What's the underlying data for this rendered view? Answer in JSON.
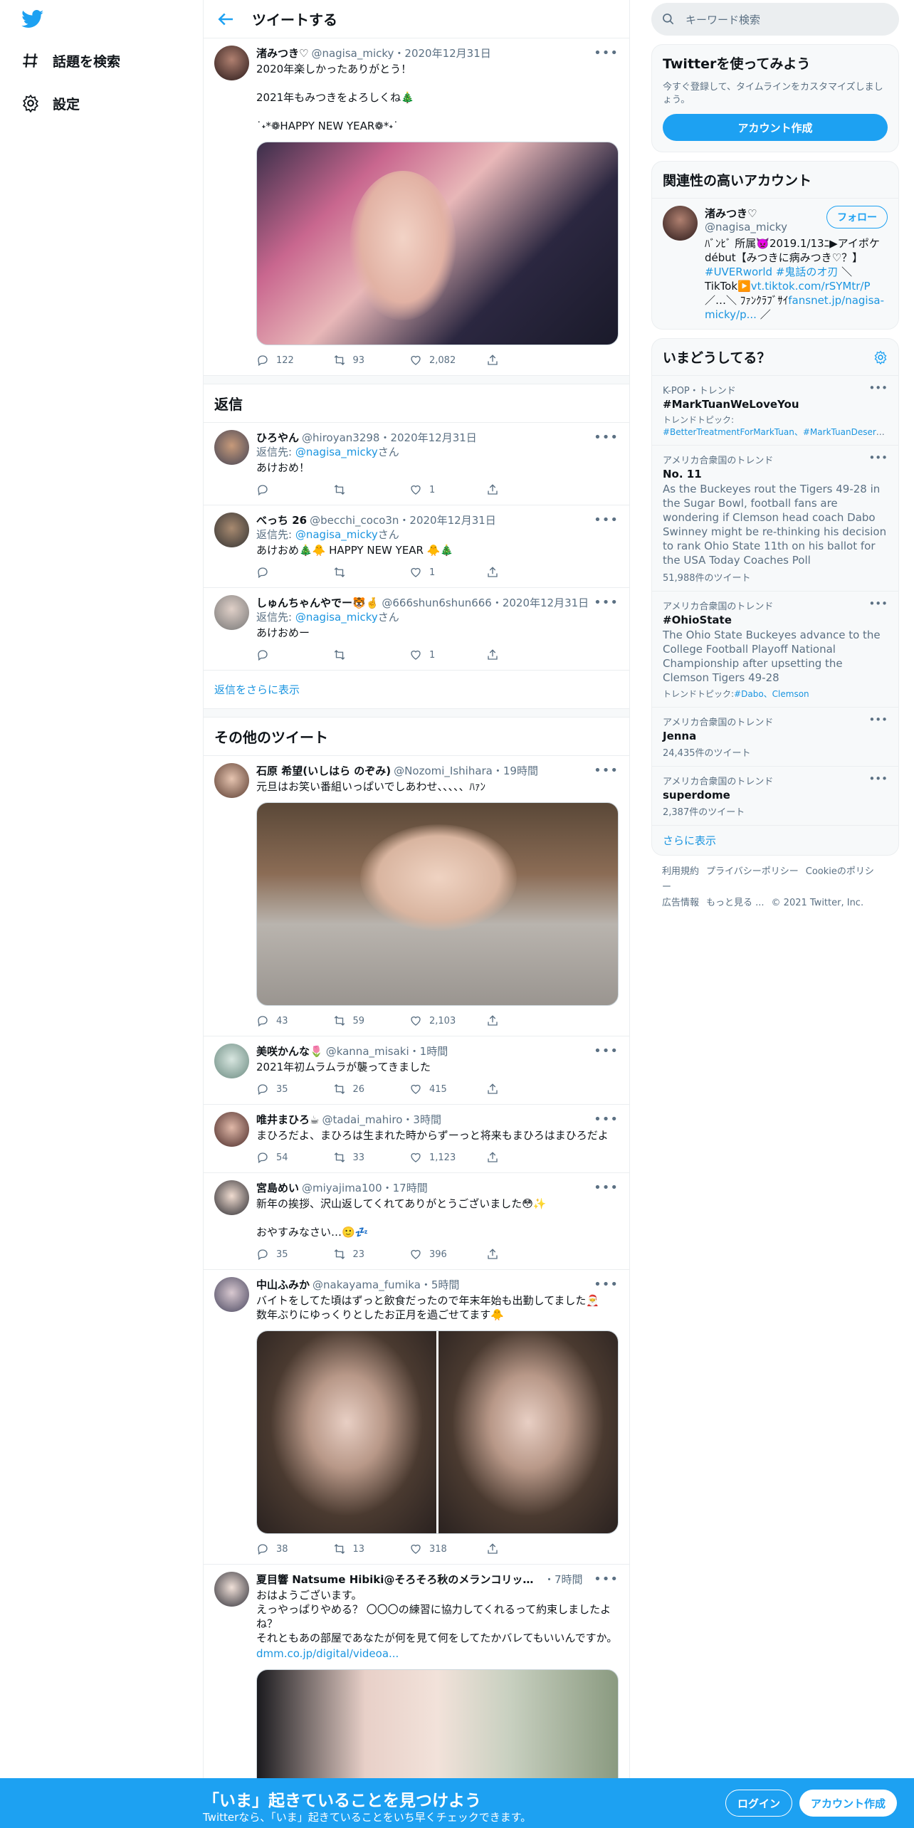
{
  "nav": {
    "explore": "話題を検索",
    "settings": "設定"
  },
  "main": {
    "title": "ツイートする",
    "mainTweet": {
      "name": "渚みつき♡",
      "meta": "@nagisa_micky・2020年12月31日",
      "text": "2020年楽しかったありがとう！\n\n2021年もみつきをよろしくね🎄\n\n˙˖*❁HAPPY NEW YEAR❁*˖˙",
      "replies": "122",
      "retweets": "93",
      "likes": "2,082"
    },
    "repliesTitle": "返信",
    "replyToLabel": "返信先:",
    "replyToHandle": "@nagisa_micky",
    "replyToSuffix": "さん",
    "replies": [
      {
        "name": "ひろやん",
        "meta": "@hiroyan3298・2020年12月31日",
        "text": "あけおめ！",
        "likes": "1"
      },
      {
        "name": "べっち 26",
        "meta": "@becchi_coco3n・2020年12月31日",
        "text": "あけおめ🎄🐥 HAPPY NEW YEAR 🐥🎄",
        "likes": "1"
      },
      {
        "name": "しゅんちゃんやでー🐯🤞",
        "meta": "@666shun6shun666・2020年12月31日",
        "text": "あけおめー",
        "likes": "1"
      }
    ],
    "showMoreReplies": "返信をさらに表示",
    "otherTitle": "その他のツイート",
    "others": [
      {
        "name": "石原 希望(いしはら のぞみ)",
        "meta": "@Nozomi_Ishihara・19時間",
        "text": "元旦はお笑い番組いっぱいでしあわせ、、、、、ﾊｧﾝ",
        "replies": "43",
        "retweets": "59",
        "likes": "2,103"
      },
      {
        "name": "美咲かんな🌷",
        "meta": "@kanna_misaki・1時間",
        "text": "2021年初ムラムラが襲ってきました",
        "replies": "35",
        "retweets": "26",
        "likes": "415"
      },
      {
        "name": "唯井まひろ☕",
        "meta": "@tadai_mahiro・3時間",
        "text": "まひろだよ、まひろは生まれた時からずーっと将来もまひろはまひろだよ",
        "replies": "54",
        "retweets": "33",
        "likes": "1,123"
      },
      {
        "name": "宮島めい",
        "meta": "@miyajima100・17時間",
        "text": "新年の挨拶、沢山返してくれてありがとうございました😳✨\n\nおやすみなさい…🙂💤",
        "replies": "35",
        "retweets": "23",
        "likes": "396"
      },
      {
        "name": "中山ふみか",
        "meta": "@nakayama_fumika・5時間",
        "text": "バイトをしてた頃はずっと飲食だったので年末年始も出勤してました🎅\n数年ぶりにゆっくりとしたお正月を過ごせてます🐥",
        "replies": "38",
        "retweets": "13",
        "likes": "318"
      },
      {
        "name": "夏目響 Natsume Hibiki@そろそろ秋のメランコリックから...",
        "meta": "・7時間",
        "text": "おはようございます。\nえっやっぱりやめる？ 〇〇〇の練習に協力してくれるって約束しましたよね？\nそれともあの部屋であなたが何を見て何をしてたかバレてもいいんですか。",
        "link": "dmm.co.jp/digital/videoa..."
      }
    ]
  },
  "right": {
    "searchPlaceholder": "キーワード検索",
    "tryTitle": "Twitterを使ってみよう",
    "trySub": "今すぐ登録して、タイムラインをカスタマイズしましょう。",
    "createAccount": "アカウント作成",
    "relevantTitle": "関連性の高いアカウント",
    "account": {
      "name": "渚みつき♡",
      "handle": "@nagisa_micky",
      "follow": "フォロー",
      "bio": "ﾊﾞﾝﾋﾞ 所属👿2019.1/13ﾆ▶アイポケdébut【みつきに病みつき♡？】",
      "bioTags": "#UVERworld #鬼話のオ刃",
      "bioMid": " ＼ TikTok▶️",
      "bioLink1": "vt.tiktok.com/rSYMtr/P",
      "bioMid2": "／…＼ ﾌｧﾝｸﾗﾌﾞｻｲ",
      "bioLink2": "fansnet.jp/nagisa-micky/p...",
      "bioEnd": " ／"
    },
    "trendsTitle": "いまどうしてる？",
    "trends": [
      {
        "ctx": "K-POP・トレンド",
        "title": "#MarkTuanWeLoveYou",
        "topicLabel": "トレンドトピック:",
        "topics": "#BetterTreatmentForMarkTuan、#MarkTuanDeserve..."
      },
      {
        "ctx": "アメリカ合衆国のトレンド",
        "title": "No. 11",
        "desc": "As the Buckeyes rout the Tigers 49-28 in the Sugar Bowl, football fans are wondering if Clemson head coach Dabo Swinney might be re-thinking his decision to rank Ohio State 11th on his ballot for the USA Today Coaches Poll",
        "count": "51,988件のツイート"
      },
      {
        "ctx": "アメリカ合衆国のトレンド",
        "title": "#OhioState",
        "desc": "The Ohio State Buckeyes advance to the College Football Playoff National Championship after upsetting the Clemson Tigers 49-28",
        "topicLabel": "トレンドトピック:",
        "topics": "#Dabo、Clemson"
      },
      {
        "ctx": "アメリカ合衆国のトレンド",
        "title": "Jenna",
        "count": "24,435件のツイート"
      },
      {
        "ctx": "アメリカ合衆国のトレンド",
        "title": "superdome",
        "count": "2,387件のツイート"
      }
    ],
    "showMore": "さらに表示",
    "footer": [
      "利用規約",
      "プライバシーポリシー",
      "Cookieのポリシー",
      "広告情報",
      "もっと見る ...",
      "© 2021 Twitter, Inc."
    ]
  },
  "bottom": {
    "title": "「いま」起きていることを見つけよう",
    "sub": "Twitterなら、「いま」起きていることをいち早くチェックできます。",
    "login": "ログイン",
    "signup": "アカウント作成"
  },
  "colors": {
    "accent": "#1da1f2",
    "link": "#1b95e0"
  }
}
